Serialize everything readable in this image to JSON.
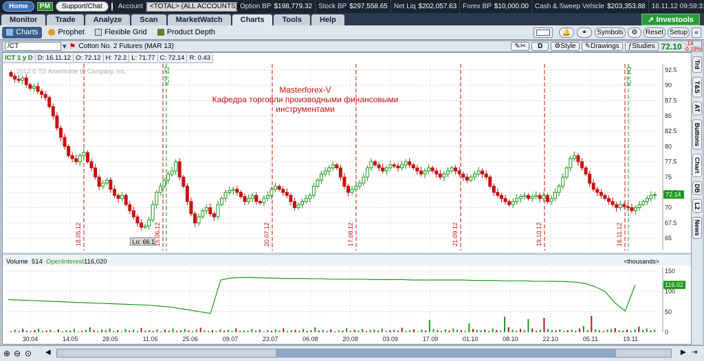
{
  "topbar": {
    "home": "Home",
    "pm": "PM",
    "support": "Support/Chat",
    "account_label": "Account",
    "account_value": "<TOTAL> (ALL ACCOUNTS)",
    "option_bp_label": "Option BP",
    "option_bp": "$198,779.32",
    "stock_bp_label": "Stock BP",
    "stock_bp": "$297,558.65",
    "net_liq_label": "Net Liq",
    "net_liq": "$202,057.63",
    "forex_bp_label": "Forex BP",
    "forex_bp": "$10,000.00",
    "cash_label": "Cash & Sweep Vehicle",
    "cash": "$203,353.88",
    "datetime": "16.11.12 09:59:31 EET"
  },
  "nav": {
    "tabs": [
      "Monitor",
      "Trade",
      "Analyze",
      "Scan",
      "MarketWatch",
      "Charts",
      "Tools",
      "Help"
    ],
    "active": "Charts",
    "investools": "Investools"
  },
  "subnav": {
    "tabs": [
      "Charts",
      "Prophet",
      "Flexible Grid",
      "Product Depth"
    ],
    "symbols": "Symbols",
    "reset": "Reset",
    "setup": "Setup"
  },
  "chartbar": {
    "symbol": "/CT",
    "description": "Cotton No. 2 Futures (MAR 13)",
    "d_btn": "D",
    "style": "Style",
    "drawings": "Drawings",
    "studies": "Studies",
    "last": "72.10",
    "change": "-.14",
    "change_pct": "-0.19%"
  },
  "ohlc": {
    "sym": "/CT 1 y D",
    "d": "D: 16.11.12",
    "o": "O: 72.12",
    "h": "H: 72.2",
    "l": "L: 71.77",
    "c": "C: 72.14",
    "r": "R: 0.43"
  },
  "watermark": "2012 © TD Ameritrade IP Company, Inc.",
  "annotation": [
    "Masterforex-V",
    "Кафедра торговли производными финансовыми",
    "инструментами"
  ],
  "low_label": "Lo: 66.1",
  "price_tag": "72.14",
  "volume": {
    "volume_label": "Volume",
    "volume_value": "514",
    "oi_label": "OpenInterest",
    "oi_value": "116,020",
    "thousands": "<thousands>",
    "oi_tag": "116.02"
  },
  "side_tabs": [
    "Trd",
    "T&S",
    "AT",
    "Buttons",
    "Chart",
    "DB",
    "L2",
    "News"
  ],
  "colors": {
    "up": "#1a9a1a",
    "down": "#c81010",
    "oi": "#1a9a1a",
    "event": "#c81010",
    "expiry": "#1a9a1a"
  },
  "chart_data": {
    "type": "candlestick",
    "price_axis": {
      "min": 63,
      "max": 93.5,
      "ticks": [
        65,
        67.5,
        70,
        72.5,
        75,
        77.5,
        80,
        82.5,
        85,
        87.5,
        90,
        92.5
      ]
    },
    "volume_axis": {
      "min": 0,
      "max": 160,
      "ticks": [
        0,
        50,
        100,
        150
      ]
    },
    "x_ticks": [
      "30.04",
      "14.05",
      "28.05",
      "11.06",
      "25.06",
      "09.07",
      "23.07",
      "06.08",
      "20.08",
      "03.09",
      "17.09",
      "01.10",
      "08.10",
      "22.10",
      "05.11",
      "19.11"
    ],
    "event_lines": [
      {
        "label": "18.05.12",
        "kind": "event"
      },
      {
        "label": "15.06.12",
        "kind": "event"
      },
      {
        "label": "ICT Z2",
        "kind": "expiry"
      },
      {
        "label": "20.07.12",
        "kind": "event"
      },
      {
        "label": "17.08.12",
        "kind": "event"
      },
      {
        "label": "21.09.12",
        "kind": "event"
      },
      {
        "label": "19.10.12",
        "kind": "event"
      },
      {
        "label": "16.11.12",
        "kind": "event"
      },
      {
        "label": "ICT H3",
        "kind": "expiry"
      }
    ],
    "closes": [
      91.5,
      91.0,
      90.8,
      91.2,
      90.1,
      89.5,
      89.8,
      89.0,
      88.5,
      88.0,
      86.5,
      85.0,
      83.0,
      81.5,
      80.0,
      78.5,
      78.0,
      77.5,
      78.5,
      79.0,
      77.5,
      76.5,
      75.0,
      73.5,
      74.0,
      74.5,
      73.0,
      72.0,
      71.5,
      72.0,
      70.5,
      69.5,
      68.5,
      67.5,
      66.8,
      67.0,
      68.0,
      70.5,
      72.5,
      73.5,
      74.5,
      75.5,
      76.0,
      77.5,
      75.0,
      73.5,
      71.0,
      69.0,
      67.5,
      68.5,
      69.5,
      70.0,
      69.0,
      68.5,
      70.5,
      71.5,
      72.5,
      72.8,
      73.0,
      72.5,
      71.8,
      71.0,
      71.5,
      72.0,
      71.0,
      70.8,
      71.5,
      72.0,
      73.0,
      73.5,
      73.0,
      72.5,
      72.0,
      71.0,
      70.0,
      70.5,
      71.0,
      71.5,
      72.0,
      73.5,
      74.5,
      75.5,
      76.0,
      76.5,
      77.0,
      76.5,
      75.0,
      73.5,
      72.5,
      73.0,
      73.5,
      74.0,
      75.0,
      76.5,
      77.5,
      77.0,
      76.5,
      76.0,
      76.5,
      77.0,
      76.8,
      76.5,
      77.0,
      77.5,
      77.0,
      76.5,
      76.0,
      75.5,
      76.0,
      76.5,
      76.0,
      75.5,
      75.0,
      75.5,
      76.0,
      76.5,
      76.0,
      75.5,
      75.0,
      74.5,
      75.0,
      75.5,
      76.0,
      75.5,
      75.0,
      73.5,
      72.5,
      72.0,
      71.5,
      71.0,
      70.5,
      71.0,
      71.5,
      71.8,
      72.0,
      71.5,
      71.8,
      72.0,
      71.5,
      72.0,
      71.0,
      71.5,
      72.5,
      73.5,
      75.0,
      76.5,
      78.0,
      78.5,
      77.5,
      76.5,
      75.5,
      74.0,
      73.0,
      72.5,
      72.0,
      71.5,
      71.0,
      70.5,
      70.0,
      70.5,
      70.2,
      70.0,
      69.5,
      70.0,
      70.5,
      71.0,
      71.5,
      72.0,
      72.14
    ],
    "open_interest": [
      80,
      79,
      78,
      77,
      76,
      75,
      74,
      73,
      72,
      71,
      70,
      69,
      68,
      67,
      66,
      64,
      62,
      58,
      54,
      50,
      46,
      128,
      133,
      134,
      134,
      133,
      133,
      132,
      132,
      132,
      131,
      131,
      130,
      130,
      130,
      130,
      129,
      129,
      129,
      129,
      128,
      128,
      128,
      128,
      128,
      128,
      127,
      127,
      127,
      126,
      126,
      126,
      125,
      125,
      125,
      124,
      123,
      120,
      112,
      100,
      72,
      52,
      116
    ],
    "volumes": [
      2,
      6,
      3,
      8,
      4,
      3,
      5,
      9,
      3,
      4,
      6,
      2,
      7,
      3,
      5,
      4,
      8,
      2,
      3,
      6,
      12,
      5,
      3,
      7,
      4,
      9,
      3,
      5,
      2,
      8,
      4,
      6,
      3,
      10,
      4,
      5,
      3,
      7,
      2,
      6,
      4,
      9,
      3,
      5,
      8,
      4,
      3,
      6,
      11,
      4,
      3,
      5,
      2,
      7,
      4,
      6,
      3,
      9,
      4,
      5,
      3,
      8,
      4,
      6,
      2,
      5,
      3,
      7,
      4,
      9,
      3,
      5,
      6,
      4,
      8,
      3,
      5,
      12,
      4,
      6,
      3,
      7,
      2,
      5,
      4,
      10,
      3,
      6,
      4,
      8,
      3,
      5,
      7,
      4,
      9,
      3,
      5,
      6,
      4,
      11,
      3,
      5,
      7,
      2,
      6,
      4,
      30,
      8,
      5,
      3,
      7,
      4,
      9,
      6,
      5,
      3,
      22,
      8,
      5,
      4,
      6,
      3,
      9,
      5,
      4,
      38,
      12,
      6,
      4,
      8,
      5,
      32,
      9,
      4,
      6,
      35,
      8,
      5,
      4,
      7,
      3,
      5,
      6,
      4,
      9,
      15,
      5,
      40,
      7,
      5,
      3,
      6,
      8,
      10,
      5,
      4,
      6,
      3,
      7,
      14,
      5,
      9,
      4,
      6
    ]
  }
}
